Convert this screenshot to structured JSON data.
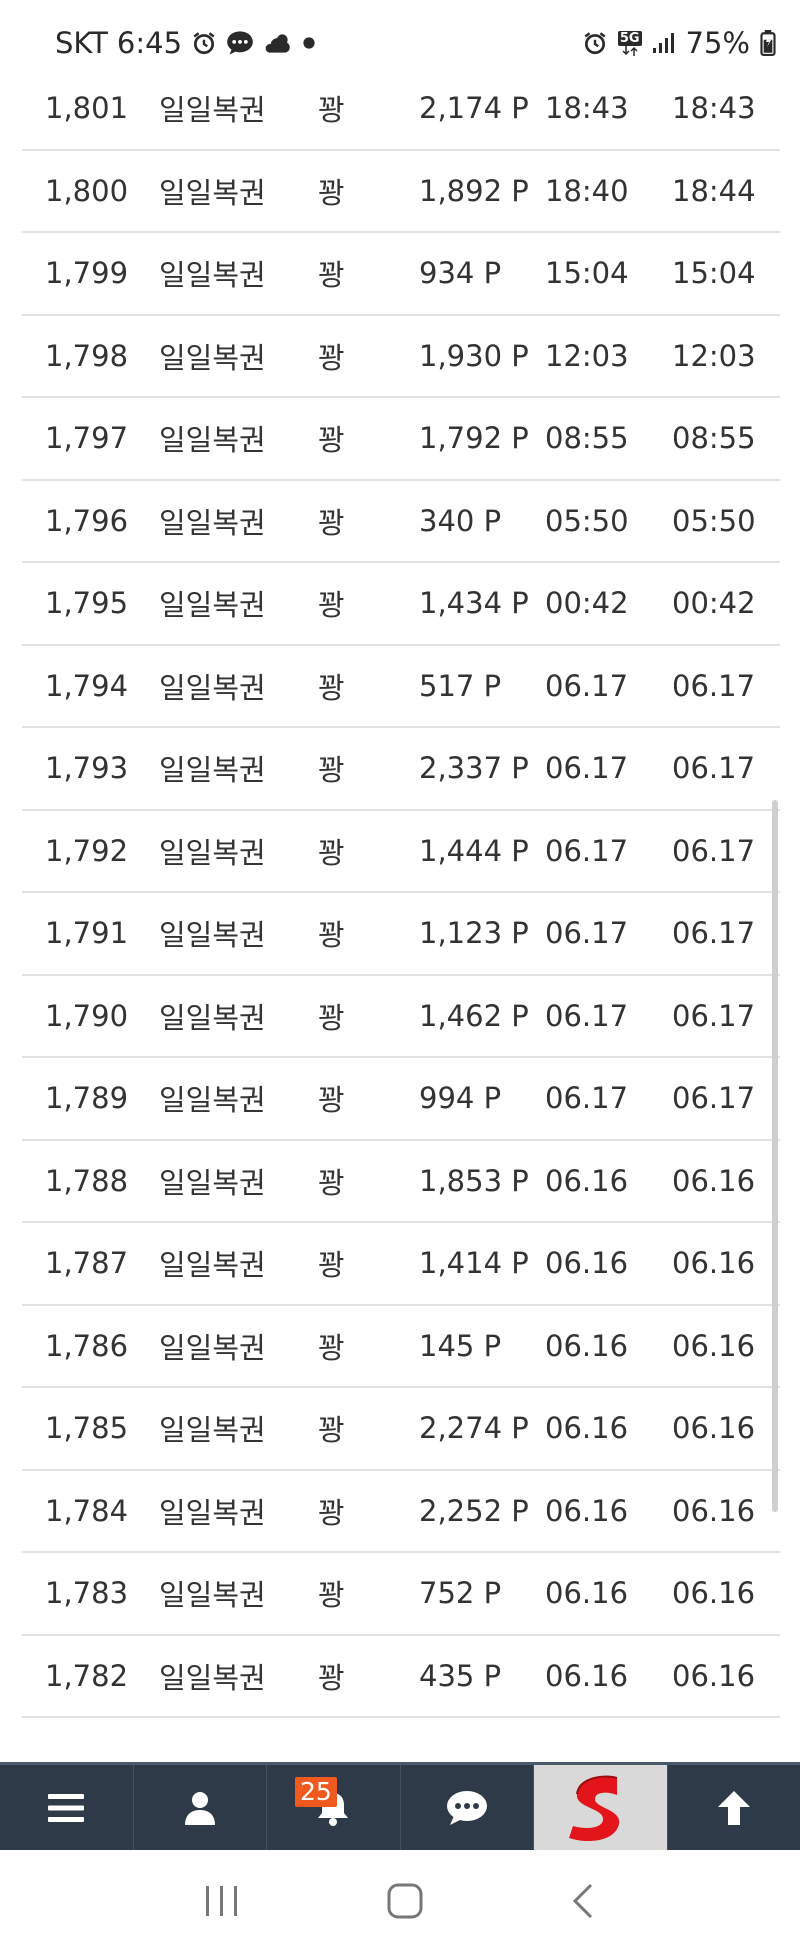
{
  "status_bar": {
    "carrier": "SKT",
    "time": "6:45",
    "network": "5G",
    "battery": "75%",
    "icons": [
      "alarm-icon",
      "chat-icon",
      "weather-icon",
      "dot-icon",
      "alarm-icon",
      "network-5g-icon",
      "signal-icon",
      "battery-icon"
    ]
  },
  "list": {
    "rows": [
      {
        "num": "1,801",
        "name": "일일복권",
        "status": "꽝",
        "points": "2,174 P",
        "date1": "18:43",
        "date2": "18:43"
      },
      {
        "num": "1,800",
        "name": "일일복권",
        "status": "꽝",
        "points": "1,892 P",
        "date1": "18:40",
        "date2": "18:44"
      },
      {
        "num": "1,799",
        "name": "일일복권",
        "status": "꽝",
        "points": "934 P",
        "date1": "15:04",
        "date2": "15:04"
      },
      {
        "num": "1,798",
        "name": "일일복권",
        "status": "꽝",
        "points": "1,930 P",
        "date1": "12:03",
        "date2": "12:03"
      },
      {
        "num": "1,797",
        "name": "일일복권",
        "status": "꽝",
        "points": "1,792 P",
        "date1": "08:55",
        "date2": "08:55"
      },
      {
        "num": "1,796",
        "name": "일일복권",
        "status": "꽝",
        "points": "340 P",
        "date1": "05:50",
        "date2": "05:50"
      },
      {
        "num": "1,795",
        "name": "일일복권",
        "status": "꽝",
        "points": "1,434 P",
        "date1": "00:42",
        "date2": "00:42"
      },
      {
        "num": "1,794",
        "name": "일일복권",
        "status": "꽝",
        "points": "517 P",
        "date1": "06.17",
        "date2": "06.17"
      },
      {
        "num": "1,793",
        "name": "일일복권",
        "status": "꽝",
        "points": "2,337 P",
        "date1": "06.17",
        "date2": "06.17"
      },
      {
        "num": "1,792",
        "name": "일일복권",
        "status": "꽝",
        "points": "1,444 P",
        "date1": "06.17",
        "date2": "06.17"
      },
      {
        "num": "1,791",
        "name": "일일복권",
        "status": "꽝",
        "points": "1,123 P",
        "date1": "06.17",
        "date2": "06.17"
      },
      {
        "num": "1,790",
        "name": "일일복권",
        "status": "꽝",
        "points": "1,462 P",
        "date1": "06.17",
        "date2": "06.17"
      },
      {
        "num": "1,789",
        "name": "일일복권",
        "status": "꽝",
        "points": "994 P",
        "date1": "06.17",
        "date2": "06.17"
      },
      {
        "num": "1,788",
        "name": "일일복권",
        "status": "꽝",
        "points": "1,853 P",
        "date1": "06.16",
        "date2": "06.16"
      },
      {
        "num": "1,787",
        "name": "일일복권",
        "status": "꽝",
        "points": "1,414 P",
        "date1": "06.16",
        "date2": "06.16"
      },
      {
        "num": "1,786",
        "name": "일일복권",
        "status": "꽝",
        "points": "145 P",
        "date1": "06.16",
        "date2": "06.16"
      },
      {
        "num": "1,785",
        "name": "일일복권",
        "status": "꽝",
        "points": "2,274 P",
        "date1": "06.16",
        "date2": "06.16"
      },
      {
        "num": "1,784",
        "name": "일일복권",
        "status": "꽝",
        "points": "2,252 P",
        "date1": "06.16",
        "date2": "06.16"
      },
      {
        "num": "1,783",
        "name": "일일복권",
        "status": "꽝",
        "points": "752 P",
        "date1": "06.16",
        "date2": "06.16"
      },
      {
        "num": "1,782",
        "name": "일일복권",
        "status": "꽝",
        "points": "435 P",
        "date1": "06.16",
        "date2": "06.16"
      }
    ]
  },
  "bottom_nav": {
    "items": [
      "menu-icon",
      "user-icon",
      "bell-icon",
      "chat-icon",
      "site-logo",
      "arrow-up-icon"
    ],
    "notification_count": "25",
    "colors": {
      "bar": "#2f3a48",
      "badge": "#f05a1e",
      "logo": "#e3141a"
    }
  },
  "system_nav": {
    "items": [
      "recent-apps-icon",
      "home-icon",
      "back-icon"
    ]
  }
}
